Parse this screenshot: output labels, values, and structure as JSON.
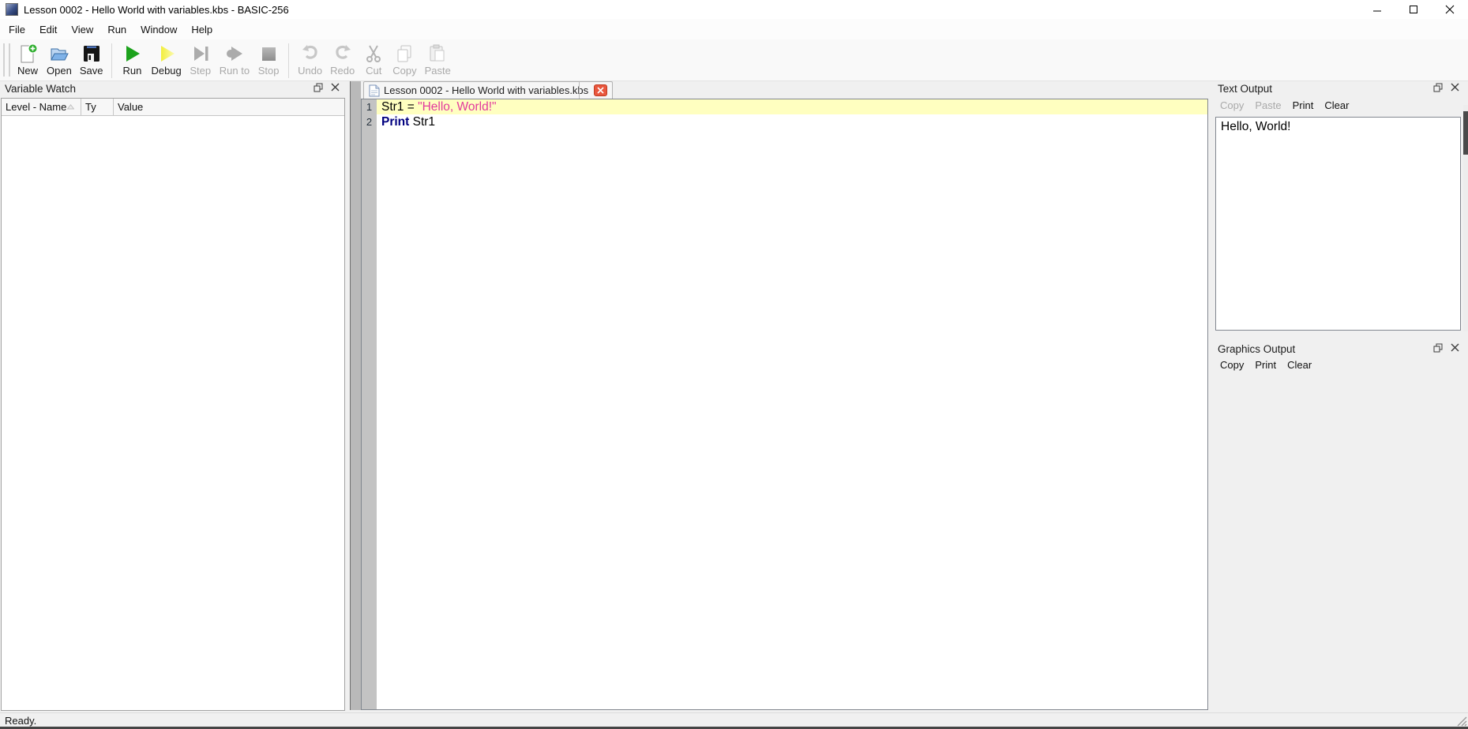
{
  "window": {
    "title": "Lesson 0002 - Hello World with variables.kbs - BASIC-256",
    "status": "Ready."
  },
  "menu": {
    "items": [
      {
        "label": "File"
      },
      {
        "label": "Edit"
      },
      {
        "label": "View"
      },
      {
        "label": "Run"
      },
      {
        "label": "Window"
      },
      {
        "label": "Help"
      }
    ]
  },
  "toolbar": {
    "buttons": [
      {
        "label": "New",
        "disabled": false
      },
      {
        "label": "Open",
        "disabled": false
      },
      {
        "label": "Save",
        "disabled": false
      },
      {
        "label": "Run",
        "disabled": false
      },
      {
        "label": "Debug",
        "disabled": false
      },
      {
        "label": "Step",
        "disabled": true
      },
      {
        "label": "Run to",
        "disabled": true
      },
      {
        "label": "Stop",
        "disabled": true
      },
      {
        "label": "Undo",
        "disabled": true
      },
      {
        "label": "Redo",
        "disabled": true
      },
      {
        "label": "Cut",
        "disabled": true
      },
      {
        "label": "Copy",
        "disabled": true
      },
      {
        "label": "Paste",
        "disabled": true
      }
    ]
  },
  "variable_watch": {
    "title": "Variable Watch",
    "columns": [
      {
        "label": "Level - Name"
      },
      {
        "label": "Ty"
      },
      {
        "label": "Value"
      }
    ]
  },
  "editor": {
    "tab": {
      "label": "Lesson 0002 - Hello World with variables.kbs"
    },
    "lines": [
      {
        "number": "1",
        "highlighted": true,
        "tokens": [
          {
            "text": "Str1 = "
          },
          {
            "text": "\"Hello, World!\"",
            "type": "string"
          }
        ]
      },
      {
        "number": "2",
        "highlighted": false,
        "tokens": [
          {
            "text": "Print",
            "type": "keyword"
          },
          {
            "text": " Str1"
          }
        ]
      }
    ]
  },
  "text_output": {
    "title": "Text Output",
    "buttons": [
      {
        "label": "Copy",
        "disabled": true
      },
      {
        "label": "Paste",
        "disabled": true
      },
      {
        "label": "Print",
        "disabled": false
      },
      {
        "label": "Clear",
        "disabled": false
      }
    ],
    "content": "Hello, World!"
  },
  "graphics_output": {
    "title": "Graphics Output",
    "buttons": [
      {
        "label": "Copy",
        "disabled": false
      },
      {
        "label": "Print",
        "disabled": false
      },
      {
        "label": "Clear",
        "disabled": false
      }
    ]
  },
  "icons": {
    "minimize": "─",
    "maximize": "□",
    "close": "✕",
    "new-file": "page-with-plus",
    "open-file": "open-folder",
    "save-file": "floppy-disk",
    "run": "▶",
    "debug": "▶",
    "step": "▶|",
    "run-to": "●▶",
    "stop": "■",
    "undo": "↶",
    "redo": "↷",
    "cut": "✂",
    "copy": "⧉",
    "paste": "clipboard",
    "float-panel": "⧉",
    "close-panel": "✕",
    "document": "page",
    "sort-indicator": "△"
  },
  "colors": {
    "keyword": "#00007f",
    "string": "#e23a9d",
    "line_highlight": "#ffffc0",
    "run_green": "#1ca21c",
    "debug_yellow": "#f2ee3c",
    "tab_close": "#e9573e",
    "gutter": "#c3c3c3"
  }
}
